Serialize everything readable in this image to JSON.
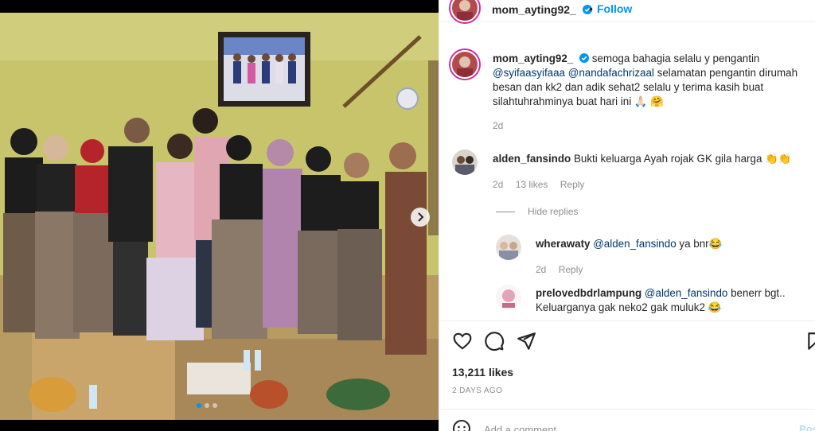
{
  "post": {
    "username": "mom_ayting92_",
    "separator": "•",
    "follow_label": "Follow",
    "caption_user": "mom_ayting92_",
    "caption_pre": "semoga bahagia selalu y pengantin",
    "caption_mention_1": "@syifaasyifaaa",
    "caption_mention_2": "@nandafachrizaal",
    "caption_post": "selamatan pengantin dirumah besan dan kk2 dan adik sehat2 selalu y terima kasih buat silahtuhrahminya buat hari ini",
    "caption_emoji": "🙏🏻 🤗",
    "caption_age": "2d"
  },
  "comments": [
    {
      "username": "alden_fansindo",
      "text": "Bukti keluarga Ayah rojak GK gila harga",
      "emoji": "👏👏",
      "age": "2d",
      "likes": "13 likes",
      "reply_label": "Reply"
    }
  ],
  "hide_replies_label": "Hide replies",
  "replies": [
    {
      "username": "wherawaty",
      "mention": "@alden_fansindo",
      "text": "ya bnr",
      "emoji": "😂",
      "age": "2d",
      "reply_label": "Reply"
    },
    {
      "username": "prelovedbdrlampung",
      "mention": "@alden_fansindo",
      "text": "benerr bgt.. Keluarganya gak neko2 gak muluk2",
      "emoji": "😂"
    }
  ],
  "like_count": "13,211 likes",
  "post_date": "2 DAYS AGO",
  "add_comment_placeholder": "Add a comment...",
  "post_label": "Post",
  "icons": {
    "like": "heart-icon",
    "comment": "comment-icon",
    "share": "paper-plane-icon",
    "save": "bookmark-icon",
    "emoji": "smiley-icon",
    "verified": "verified-badge-icon",
    "next": "chevron-right-icon"
  },
  "colors": {
    "link_blue": "#0095f6",
    "mention_blue": "#00376b",
    "secondary_text": "#8e8e8e",
    "post_disabled": "#b2dffc",
    "story_ring": "#d6249f"
  },
  "carousel": {
    "slide_count": 3,
    "active_index": 0
  }
}
